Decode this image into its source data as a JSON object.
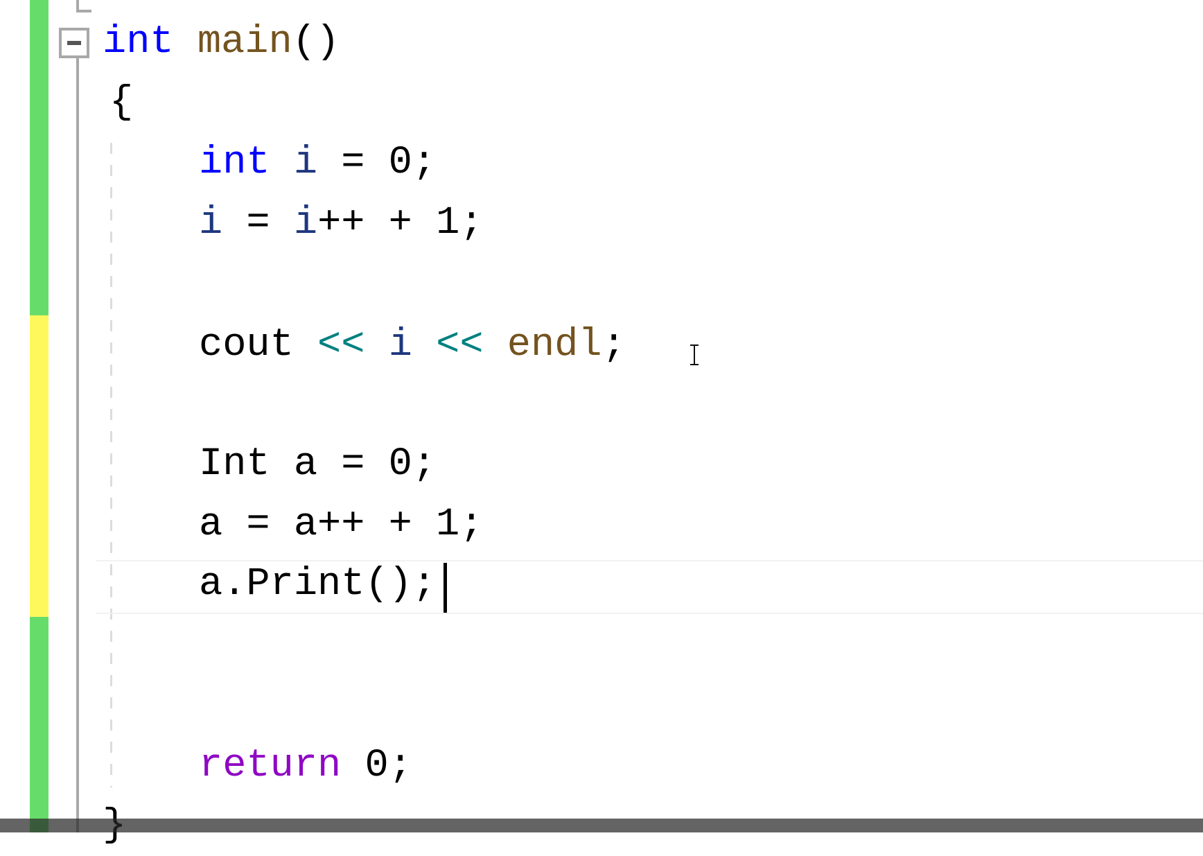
{
  "editor": {
    "colors": {
      "added": "#66dd6b",
      "modified": "#fff85c",
      "keyword": "#0000ff",
      "function": "#74531f",
      "variable": "#1f377f",
      "operator": "#008080",
      "control": "#8f08c4"
    },
    "lines": [
      {
        "tokens": [
          {
            "t": "int",
            "c": "kw"
          },
          {
            "t": " "
          },
          {
            "t": "main",
            "c": "fn"
          },
          {
            "t": "()"
          }
        ]
      },
      {
        "tokens": [
          {
            "t": "{"
          }
        ]
      },
      {
        "tokens": [
          {
            "t": "int",
            "c": "kw"
          },
          {
            "t": " "
          },
          {
            "t": "i",
            "c": "var"
          },
          {
            "t": " = 0;"
          }
        ]
      },
      {
        "tokens": [
          {
            "t": "i",
            "c": "var"
          },
          {
            "t": " = "
          },
          {
            "t": "i",
            "c": "var"
          },
          {
            "t": "++ + 1;"
          }
        ]
      },
      {
        "tokens": []
      },
      {
        "tokens": [
          {
            "t": "cout"
          },
          {
            "t": " "
          },
          {
            "t": "<<",
            "c": "op"
          },
          {
            "t": " "
          },
          {
            "t": "i",
            "c": "var"
          },
          {
            "t": " "
          },
          {
            "t": "<<",
            "c": "op"
          },
          {
            "t": " "
          },
          {
            "t": "endl",
            "c": "fn"
          },
          {
            "t": ";"
          }
        ]
      },
      {
        "tokens": []
      },
      {
        "tokens": [
          {
            "t": "Int a = 0;"
          }
        ]
      },
      {
        "tokens": [
          {
            "t": "a = a++ + 1;"
          }
        ]
      },
      {
        "tokens": [
          {
            "t": "a.Print();"
          }
        ]
      },
      {
        "tokens": []
      },
      {
        "tokens": []
      },
      {
        "tokens": [
          {
            "t": "return",
            "c": "ret"
          },
          {
            "t": " 0;"
          }
        ]
      },
      {
        "tokens": [
          {
            "t": "}"
          }
        ]
      }
    ]
  }
}
